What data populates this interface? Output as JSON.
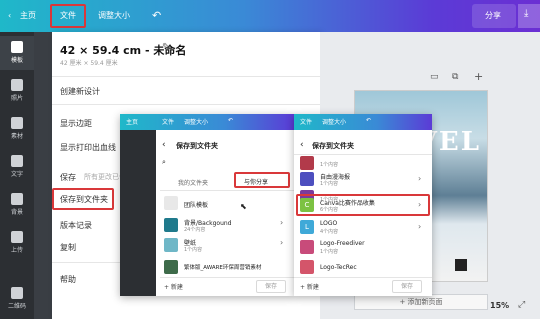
{
  "topbar": {
    "home": "主页",
    "file": "文件",
    "resize": "调整大小",
    "undo_icon": "↶",
    "share": "分享",
    "download_icon": "⤓"
  },
  "rail": [
    {
      "label": "模板"
    },
    {
      "label": "照片"
    },
    {
      "label": "素材"
    },
    {
      "label": "文字"
    },
    {
      "label": "背景"
    },
    {
      "label": "上传"
    },
    {
      "label": "二维码"
    }
  ],
  "menu": {
    "title": "42 × 59.4 cm - 未命名",
    "subtitle": "42 厘米 × 59.4 厘米",
    "new_design": "创建新设计",
    "show_margins": "显示边距",
    "show_bleed": "显示打印出血线",
    "save": "保存",
    "save_hint": "所有更改已保存",
    "save_to_folder": "保存到文件夹",
    "version_history": "版本记录",
    "copy": "复制",
    "help": "帮助"
  },
  "canvas": {
    "poster_text": "VEL",
    "add_page": "+ 添加新页面",
    "zoom": "15%"
  },
  "shot1": {
    "home": "主页",
    "file": "文件",
    "resize": "调整大小",
    "title": "保存到文件夹",
    "tab_mine": "我的文件夹",
    "tab_shared": "与你分享",
    "rows": [
      {
        "title": "团队模板",
        "sub": ""
      },
      {
        "title": "背景/Backgound",
        "sub": "24个内容"
      },
      {
        "title": "壁纸",
        "sub": "1个内容"
      },
      {
        "title": "繁体版_AWARE环保周营销素材",
        "sub": ""
      }
    ],
    "new": "+ 新建",
    "save_btn": "保存"
  },
  "shot2": {
    "file": "文件",
    "resize": "调整大小",
    "title": "保存到文件夹",
    "rows": [
      {
        "title": "",
        "sub": "1个内容"
      },
      {
        "title": "自由漫海报",
        "sub": "1个内容"
      },
      {
        "title": "",
        "sub": "1个内容"
      },
      {
        "title": "Canva比赛作品收集",
        "sub": "6个内容"
      },
      {
        "title": "LOGO",
        "sub": "4个内容"
      },
      {
        "title": "Logo-Freediver",
        "sub": "1个内容"
      },
      {
        "title": "Logo-TecRec",
        "sub": ""
      }
    ],
    "new": "+ 新建",
    "save_btn": "保存"
  },
  "colors": {
    "accent": "#3a8ad6",
    "highlight": "#d9383a",
    "brand_purple": "#6b2fd3"
  }
}
